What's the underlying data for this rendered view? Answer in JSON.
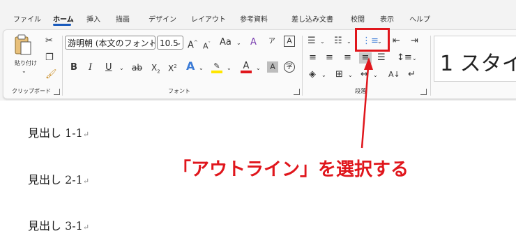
{
  "tabs": [
    "ファイル",
    "ホーム",
    "挿入",
    "描画",
    "デザイン",
    "レイアウト",
    "参考資料",
    "差し込み文書",
    "校閲",
    "表示",
    "ヘルプ"
  ],
  "active_tab": "ホーム",
  "clipboard": {
    "paste_label": "貼り付け",
    "group_label": "クリップボード"
  },
  "font": {
    "font_name": "游明朝 (本文のフォント)",
    "font_size": "10.5",
    "change_case": "Aa",
    "group_label": "フォント"
  },
  "paragraph": {
    "group_label": "段落"
  },
  "styles": {
    "preview_text": "1 スタイ"
  },
  "document": {
    "lines": [
      "見出し 1-1",
      "見出し 2-1",
      "見出し 3-1"
    ]
  },
  "annotation": {
    "text": "「アウトライン」を選択する",
    "color": "#e0161c"
  },
  "colors": {
    "accent": "#185abd",
    "highlight": "#e0161c",
    "font_color": "#e0161c",
    "highlighter": "#ffe600"
  }
}
